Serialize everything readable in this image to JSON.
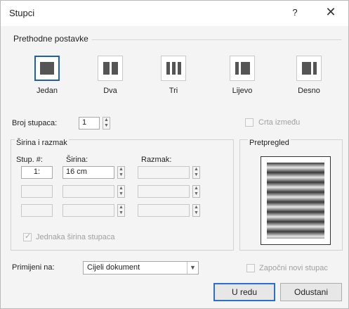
{
  "window": {
    "title": "Stupci",
    "help": "?",
    "close": "✕"
  },
  "presets": {
    "heading": "Prethodne postavke",
    "items": [
      {
        "label": "Jedan",
        "icon": "one-column-icon",
        "selected": true
      },
      {
        "label": "Dva",
        "icon": "two-columns-icon",
        "selected": false
      },
      {
        "label": "Tri",
        "icon": "three-columns-icon",
        "selected": false
      },
      {
        "label": "Lijevo",
        "icon": "left-column-icon",
        "selected": false
      },
      {
        "label": "Desno",
        "icon": "right-column-icon",
        "selected": false
      }
    ]
  },
  "columns": {
    "label": "Broj stupaca:",
    "value": "1"
  },
  "line_between": {
    "label": "Crta između",
    "checked": false
  },
  "width_spacing": {
    "heading": "Širina i razmak",
    "col_header": "Stup. #:",
    "width_header": "Širina:",
    "spacing_header": "Razmak:",
    "rows": [
      {
        "col": "1:",
        "width": "16 cm",
        "spacing": ""
      },
      {
        "col": "",
        "width": "",
        "spacing": ""
      },
      {
        "col": "",
        "width": "",
        "spacing": ""
      }
    ],
    "equal_width": {
      "label": "Jednaka širina stupaca",
      "checked": true
    }
  },
  "preview": {
    "heading": "Pretpregled"
  },
  "apply_to": {
    "label": "Primijeni na:",
    "value": "Cijeli dokument"
  },
  "new_column": {
    "label": "Započni novi stupac",
    "checked": false
  },
  "buttons": {
    "ok": "U redu",
    "cancel": "Odustani"
  },
  "colors": {
    "accent": "#1e5fb6",
    "ok_border": "#2a6fd3"
  }
}
